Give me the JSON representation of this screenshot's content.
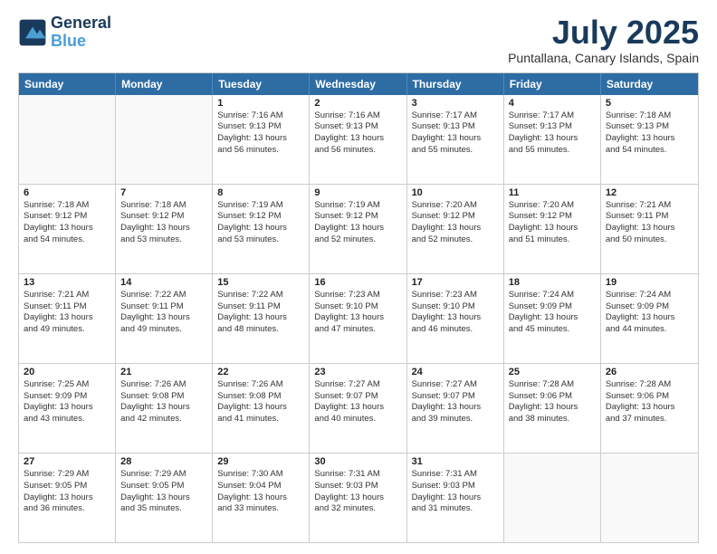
{
  "header": {
    "logo_general": "General",
    "logo_blue": "Blue",
    "main_title": "July 2025",
    "subtitle": "Puntallana, Canary Islands, Spain"
  },
  "day_headers": [
    "Sunday",
    "Monday",
    "Tuesday",
    "Wednesday",
    "Thursday",
    "Friday",
    "Saturday"
  ],
  "weeks": [
    {
      "days": [
        {
          "num": "",
          "empty": true
        },
        {
          "num": "",
          "empty": true
        },
        {
          "num": "1",
          "sunrise": "7:16 AM",
          "sunset": "9:13 PM",
          "daylight": "13 hours and 56 minutes."
        },
        {
          "num": "2",
          "sunrise": "7:16 AM",
          "sunset": "9:13 PM",
          "daylight": "13 hours and 56 minutes."
        },
        {
          "num": "3",
          "sunrise": "7:17 AM",
          "sunset": "9:13 PM",
          "daylight": "13 hours and 55 minutes."
        },
        {
          "num": "4",
          "sunrise": "7:17 AM",
          "sunset": "9:13 PM",
          "daylight": "13 hours and 55 minutes."
        },
        {
          "num": "5",
          "sunrise": "7:18 AM",
          "sunset": "9:13 PM",
          "daylight": "13 hours and 54 minutes."
        }
      ]
    },
    {
      "days": [
        {
          "num": "6",
          "sunrise": "7:18 AM",
          "sunset": "9:12 PM",
          "daylight": "13 hours and 54 minutes."
        },
        {
          "num": "7",
          "sunrise": "7:18 AM",
          "sunset": "9:12 PM",
          "daylight": "13 hours and 53 minutes."
        },
        {
          "num": "8",
          "sunrise": "7:19 AM",
          "sunset": "9:12 PM",
          "daylight": "13 hours and 53 minutes."
        },
        {
          "num": "9",
          "sunrise": "7:19 AM",
          "sunset": "9:12 PM",
          "daylight": "13 hours and 52 minutes."
        },
        {
          "num": "10",
          "sunrise": "7:20 AM",
          "sunset": "9:12 PM",
          "daylight": "13 hours and 52 minutes."
        },
        {
          "num": "11",
          "sunrise": "7:20 AM",
          "sunset": "9:12 PM",
          "daylight": "13 hours and 51 minutes."
        },
        {
          "num": "12",
          "sunrise": "7:21 AM",
          "sunset": "9:11 PM",
          "daylight": "13 hours and 50 minutes."
        }
      ]
    },
    {
      "days": [
        {
          "num": "13",
          "sunrise": "7:21 AM",
          "sunset": "9:11 PM",
          "daylight": "13 hours and 49 minutes."
        },
        {
          "num": "14",
          "sunrise": "7:22 AM",
          "sunset": "9:11 PM",
          "daylight": "13 hours and 49 minutes."
        },
        {
          "num": "15",
          "sunrise": "7:22 AM",
          "sunset": "9:11 PM",
          "daylight": "13 hours and 48 minutes."
        },
        {
          "num": "16",
          "sunrise": "7:23 AM",
          "sunset": "9:10 PM",
          "daylight": "13 hours and 47 minutes."
        },
        {
          "num": "17",
          "sunrise": "7:23 AM",
          "sunset": "9:10 PM",
          "daylight": "13 hours and 46 minutes."
        },
        {
          "num": "18",
          "sunrise": "7:24 AM",
          "sunset": "9:09 PM",
          "daylight": "13 hours and 45 minutes."
        },
        {
          "num": "19",
          "sunrise": "7:24 AM",
          "sunset": "9:09 PM",
          "daylight": "13 hours and 44 minutes."
        }
      ]
    },
    {
      "days": [
        {
          "num": "20",
          "sunrise": "7:25 AM",
          "sunset": "9:09 PM",
          "daylight": "13 hours and 43 minutes."
        },
        {
          "num": "21",
          "sunrise": "7:26 AM",
          "sunset": "9:08 PM",
          "daylight": "13 hours and 42 minutes."
        },
        {
          "num": "22",
          "sunrise": "7:26 AM",
          "sunset": "9:08 PM",
          "daylight": "13 hours and 41 minutes."
        },
        {
          "num": "23",
          "sunrise": "7:27 AM",
          "sunset": "9:07 PM",
          "daylight": "13 hours and 40 minutes."
        },
        {
          "num": "24",
          "sunrise": "7:27 AM",
          "sunset": "9:07 PM",
          "daylight": "13 hours and 39 minutes."
        },
        {
          "num": "25",
          "sunrise": "7:28 AM",
          "sunset": "9:06 PM",
          "daylight": "13 hours and 38 minutes."
        },
        {
          "num": "26",
          "sunrise": "7:28 AM",
          "sunset": "9:06 PM",
          "daylight": "13 hours and 37 minutes."
        }
      ]
    },
    {
      "days": [
        {
          "num": "27",
          "sunrise": "7:29 AM",
          "sunset": "9:05 PM",
          "daylight": "13 hours and 36 minutes."
        },
        {
          "num": "28",
          "sunrise": "7:29 AM",
          "sunset": "9:05 PM",
          "daylight": "13 hours and 35 minutes."
        },
        {
          "num": "29",
          "sunrise": "7:30 AM",
          "sunset": "9:04 PM",
          "daylight": "13 hours and 33 minutes."
        },
        {
          "num": "30",
          "sunrise": "7:31 AM",
          "sunset": "9:03 PM",
          "daylight": "13 hours and 32 minutes."
        },
        {
          "num": "31",
          "sunrise": "7:31 AM",
          "sunset": "9:03 PM",
          "daylight": "13 hours and 31 minutes."
        },
        {
          "num": "",
          "empty": true
        },
        {
          "num": "",
          "empty": true
        }
      ]
    }
  ]
}
